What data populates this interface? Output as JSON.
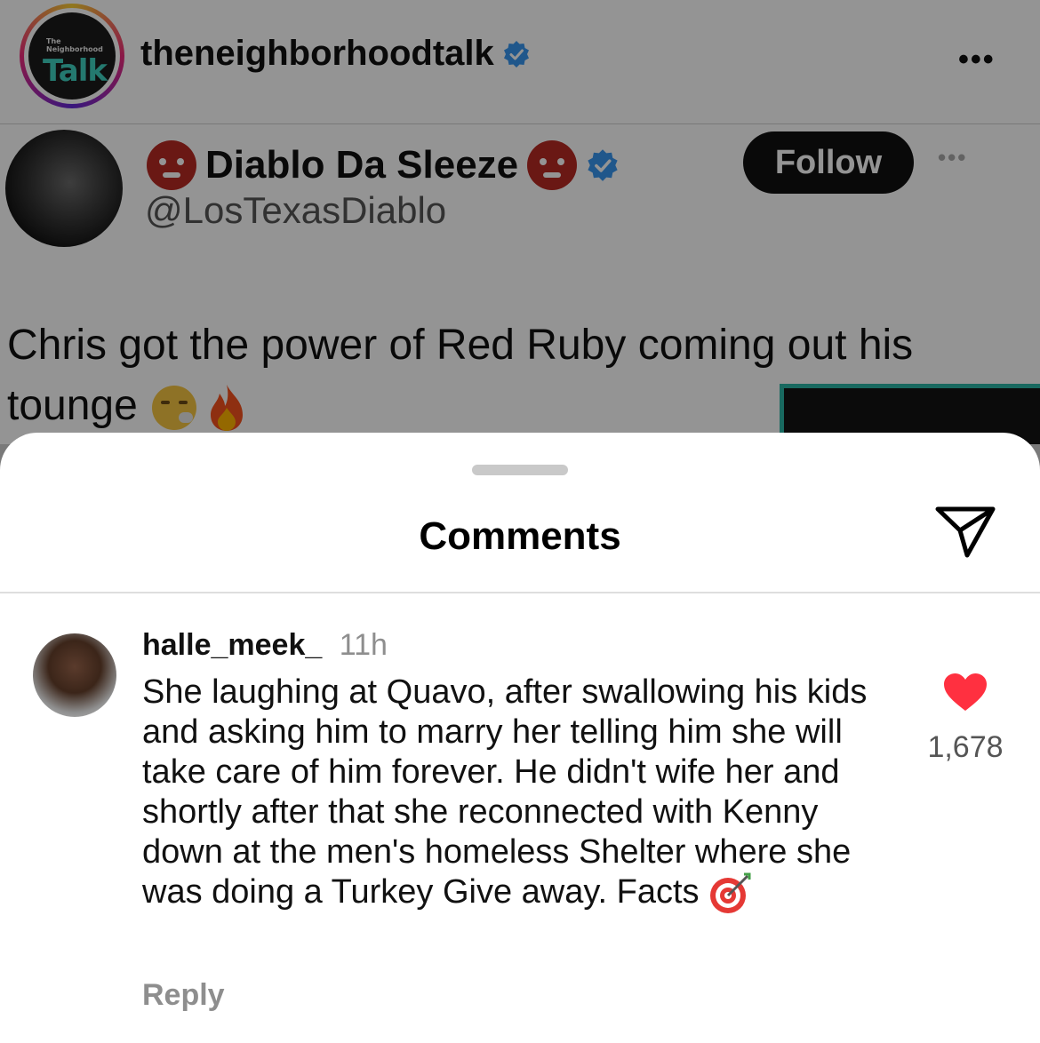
{
  "post": {
    "account_name": "theneighborhoodtalk",
    "logo": {
      "small_text": "The Neighborhood",
      "big_text": "Talk"
    },
    "header_more": "•••"
  },
  "tweet": {
    "display_name": "Diablo Da Sleeze",
    "handle": "@LosTexasDiablo",
    "follow_label": "Follow",
    "more": "•••",
    "text_line1": "Chris got the power of Red Ruby coming out his",
    "text_line2": "tounge"
  },
  "comments_sheet": {
    "title": "Comments",
    "comment": {
      "username": "halle_meek_",
      "time": "11h",
      "text": "She laughing at Quavo, after swallowing his kids and asking him to marry her telling him she will take care of him forever. He didn't wife her and shortly after that she reconnected with Kenny down at the men's homeless Shelter where she was doing a Turkey Give away.  Facts",
      "like_count": "1,678",
      "reply_label": "Reply"
    }
  },
  "colors": {
    "verified_blue": "#3897f0",
    "heart_red": "#ff3040",
    "logo_teal": "#3fd0c0"
  },
  "icons": [
    "verified-badge-icon",
    "more-icon",
    "devil-emoji-icon",
    "tired-face-emoji-icon",
    "fire-emoji-icon",
    "share-icon",
    "heart-icon",
    "target-emoji-icon"
  ]
}
